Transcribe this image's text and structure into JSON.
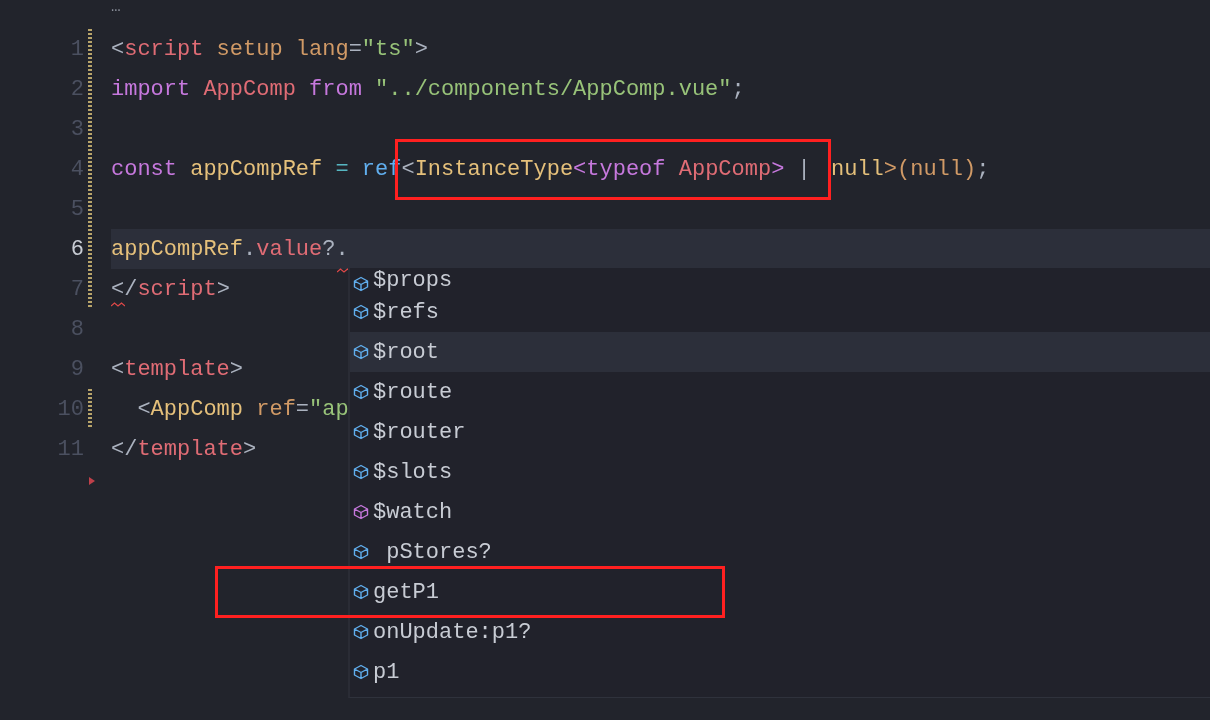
{
  "fold_hint": "…",
  "lines": [
    {
      "number": "1",
      "current": false,
      "modified": true,
      "error_mark": false,
      "deleted_marker": false,
      "tokens": [
        {
          "text": "<",
          "kind": "punct"
        },
        {
          "text": "script",
          "kind": "tag"
        },
        {
          "text": " setup lang",
          "kind": "attr"
        },
        {
          "text": "=",
          "kind": "punct"
        },
        {
          "text": "\"ts\"",
          "kind": "string"
        },
        {
          "text": ">",
          "kind": "punct"
        }
      ]
    },
    {
      "number": "2",
      "current": false,
      "modified": true,
      "error_mark": false,
      "deleted_marker": false,
      "tokens": [
        {
          "text": "import ",
          "kind": "keyword"
        },
        {
          "text": "AppComp ",
          "kind": "tag"
        },
        {
          "text": "from ",
          "kind": "keyword"
        },
        {
          "text": "\"../components/AppComp.vue\"",
          "kind": "string"
        },
        {
          "text": ";",
          "kind": "punct"
        }
      ]
    },
    {
      "number": "3",
      "current": false,
      "modified": true,
      "error_mark": false,
      "deleted_marker": false
    },
    {
      "number": "4",
      "current": false,
      "modified": true,
      "error_mark": false,
      "deleted_marker": false,
      "tokens": [
        {
          "text": "const ",
          "kind": "keyword"
        },
        {
          "text": "appCompRef",
          "kind": "variable"
        },
        {
          "text": " = ",
          "kind": "operator"
        },
        {
          "text": "ref",
          "kind": "func"
        }
      ],
      "boxed_tokens": [
        {
          "text": "<",
          "kind": "punct"
        },
        {
          "text": "InstanceType",
          "kind": "variable"
        },
        {
          "text": "<",
          "kind": "keyword"
        },
        {
          "text": "typeof ",
          "kind": "keyword"
        },
        {
          "text": "AppComp",
          "kind": "tag"
        },
        {
          "text": ">",
          "kind": "keyword"
        },
        {
          "text": " | ",
          "kind": "punct"
        }
      ],
      "after_tokens": [
        {
          "text": "null",
          "kind": "variable"
        },
        {
          "text": ">(null)",
          "kind": "attr"
        },
        {
          "text": ";",
          "kind": "punct"
        }
      ]
    },
    {
      "number": "5",
      "current": false,
      "modified": true,
      "error_mark": false,
      "deleted_marker": false
    },
    {
      "number": "6",
      "current": true,
      "modified": true,
      "error_mark": true,
      "deleted_marker": false,
      "tokens": [
        {
          "text": "appCompRef",
          "kind": "variable"
        },
        {
          "text": ".",
          "kind": "punct"
        },
        {
          "text": "value",
          "kind": "tag"
        },
        {
          "text": "?.",
          "kind": "punct"
        }
      ]
    },
    {
      "number": "7",
      "current": false,
      "modified": true,
      "error_mark": true,
      "deleted_marker": false,
      "tokens": [
        {
          "text": "</",
          "kind": "punct"
        },
        {
          "text": "script",
          "kind": "tag"
        },
        {
          "text": ">",
          "kind": "punct"
        }
      ]
    },
    {
      "number": "8",
      "current": false,
      "modified": false,
      "error_mark": false,
      "deleted_marker": false
    },
    {
      "number": "9",
      "current": false,
      "modified": false,
      "error_mark": false,
      "deleted_marker": false,
      "tokens": [
        {
          "text": "<",
          "kind": "punct"
        },
        {
          "text": "template",
          "kind": "tag"
        },
        {
          "text": ">",
          "kind": "punct"
        }
      ]
    },
    {
      "number": "10",
      "current": false,
      "modified": true,
      "error_mark": false,
      "deleted_marker": false,
      "tokens": [
        {
          "text": "  <",
          "kind": "punct"
        },
        {
          "text": "AppComp",
          "kind": "variable"
        },
        {
          "text": " ref",
          "kind": "attr"
        },
        {
          "text": "=",
          "kind": "punct"
        },
        {
          "text": "\"ap",
          "kind": "string"
        }
      ]
    },
    {
      "number": "11",
      "current": false,
      "modified": false,
      "error_mark": false,
      "deleted_marker": true,
      "tokens": [
        {
          "text": "</",
          "kind": "punct"
        },
        {
          "text": "template",
          "kind": "tag"
        },
        {
          "text": ">",
          "kind": "punct"
        }
      ]
    }
  ],
  "suggestions": [
    {
      "label": "$props",
      "kind": "property",
      "selected": false,
      "boxed": false
    },
    {
      "label": "$refs",
      "kind": "property",
      "selected": false,
      "boxed": false
    },
    {
      "label": "$root",
      "kind": "property",
      "selected": true,
      "boxed": false
    },
    {
      "label": "$route",
      "kind": "property",
      "selected": false,
      "boxed": false
    },
    {
      "label": "$router",
      "kind": "property",
      "selected": false,
      "boxed": false
    },
    {
      "label": "$slots",
      "kind": "property",
      "selected": false,
      "boxed": false
    },
    {
      "label": "$watch",
      "kind": "method",
      "selected": false,
      "boxed": false
    },
    {
      "label": " pStores?",
      "kind": "property",
      "selected": false,
      "boxed": false
    },
    {
      "label": "getP1",
      "kind": "property",
      "selected": false,
      "boxed": true
    },
    {
      "label": "onUpdate:p1?",
      "kind": "property",
      "selected": false,
      "boxed": false
    },
    {
      "label": "p1",
      "kind": "property",
      "selected": false,
      "boxed": false
    }
  ]
}
